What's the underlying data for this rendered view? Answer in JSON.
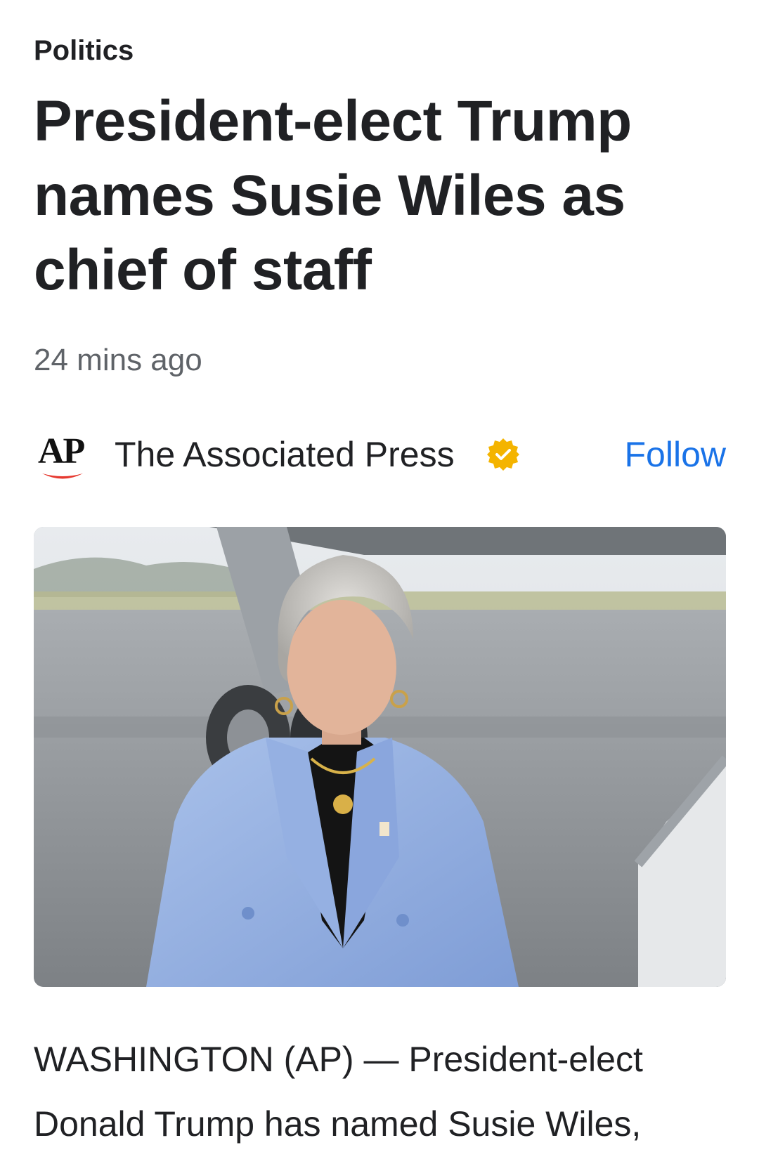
{
  "article": {
    "section": "Politics",
    "headline": "President-elect Trump names Susie Wiles as chief of staff",
    "timestamp": "24 mins ago",
    "source": {
      "logo_text": "AP",
      "name": "The Associated Press",
      "verified_icon": "verified-badge-icon",
      "follow_label": "Follow"
    },
    "hero_image": {
      "description_icon": "portrait-photo"
    },
    "body": "WASHINGTON (AP) — President-elect Donald Trump has named Susie Wiles,"
  },
  "colors": {
    "accent": "#1a73e8",
    "ap_red": "#e63930",
    "verified_gold": "#f4b400",
    "text": "#202124",
    "muted": "#5f6368"
  }
}
